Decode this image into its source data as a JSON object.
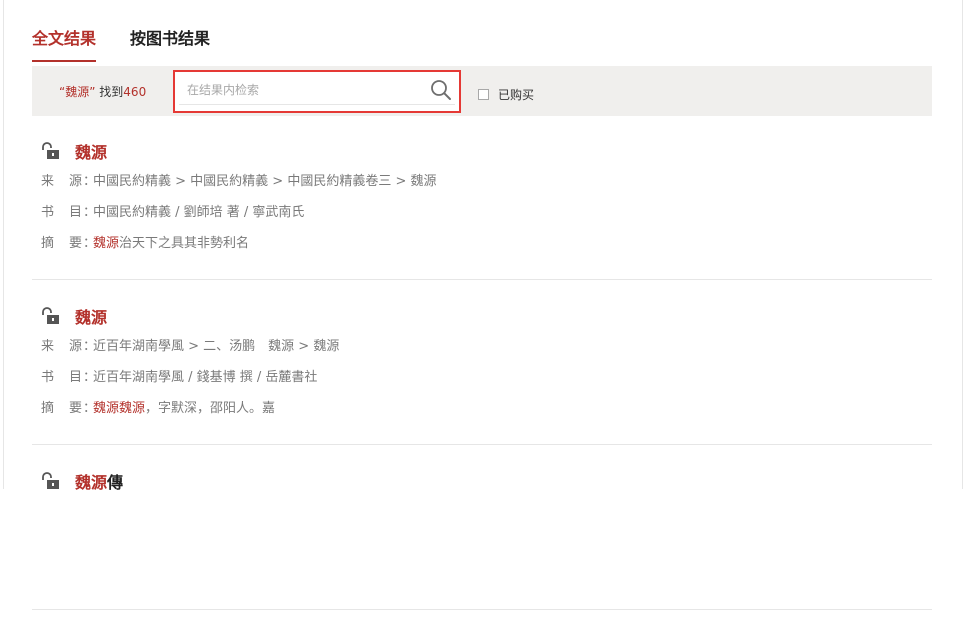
{
  "tabs": [
    {
      "label": "全文结果",
      "active": true
    },
    {
      "label": "按图书结果",
      "active": false
    }
  ],
  "search": {
    "query_prefix": "“",
    "query": "魏源",
    "query_suffix": "”",
    "found_label": "找到",
    "count": "460",
    "placeholder": "在结果内检索",
    "purchased_label": "已购买"
  },
  "results": [
    {
      "title_hl": "魏源",
      "title_rest": "",
      "source_label": "来　源：",
      "source": "中國民約精義 > 中國民約精義 > 中國民約精義卷三 > 魏源",
      "book_label": "书　目：",
      "book": "中國民約精義 / 劉師培 著 / 寧武南氏",
      "abstract_label": "摘　要：",
      "abstract_hl": "魏源",
      "abstract_rest": "治天下之具其非勢利名"
    },
    {
      "title_hl": "魏源",
      "title_rest": "",
      "source_label": "来　源：",
      "source": "近百年湖南學風 > 二、汤鹏　魏源 > 魏源",
      "book_label": "书　目：",
      "book": "近百年湖南學風 / 錢基博 撰 / 岳麓書社",
      "abstract_label": "摘　要：",
      "abstract_hl": "魏源魏源",
      "abstract_rest": "，字默深，邵阳人。嘉"
    },
    {
      "title_hl": "魏源",
      "title_rest": "傳",
      "source_label": "",
      "source": "",
      "book_label": "",
      "book": "",
      "abstract_label": "",
      "abstract_hl": "",
      "abstract_rest": ""
    }
  ],
  "colors": {
    "accent": "#b3312b",
    "search_border": "#e53935",
    "bar_bg": "#f0efed"
  }
}
